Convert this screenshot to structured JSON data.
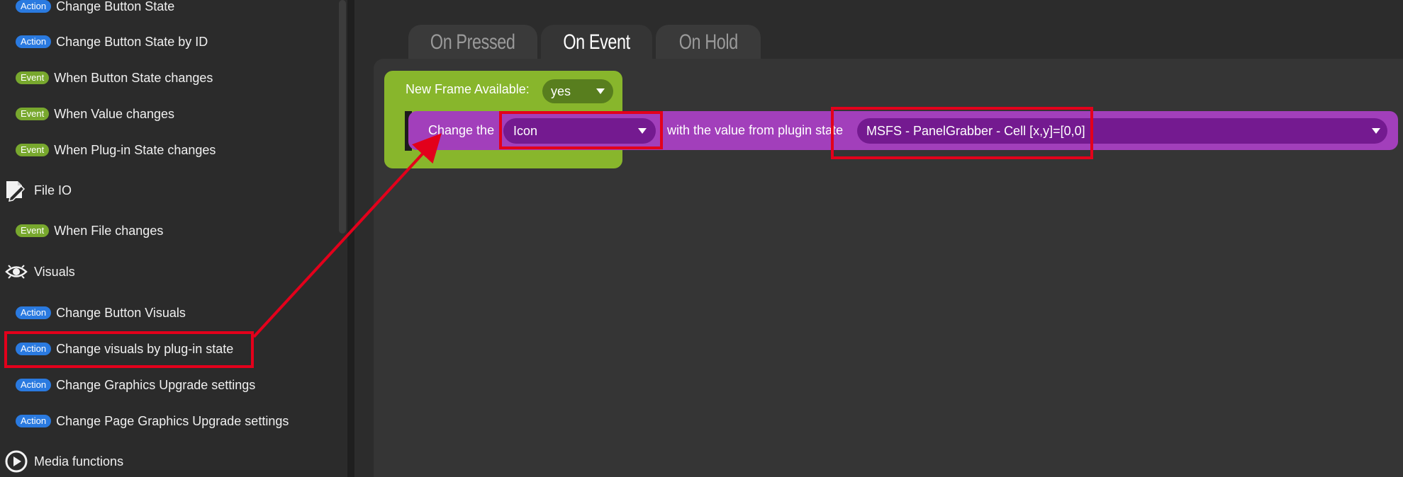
{
  "sidebar": {
    "items": [
      {
        "badge": "Action",
        "label": "Change Button State"
      },
      {
        "badge": "Action",
        "label": "Change Button State by ID"
      },
      {
        "badge": "Event",
        "label": "When Button State changes"
      },
      {
        "badge": "Event",
        "label": "When Value changes"
      },
      {
        "badge": "Event",
        "label": "When Plug-in State changes"
      },
      {
        "badge": "Event",
        "label": "When File changes"
      },
      {
        "badge": "Action",
        "label": "Change Button Visuals"
      },
      {
        "badge": "Action",
        "label": "Change visuals by plug-in state"
      },
      {
        "badge": "Action",
        "label": "Change Graphics Upgrade settings"
      },
      {
        "badge": "Action",
        "label": "Change Page Graphics Upgrade settings"
      }
    ],
    "categories": [
      {
        "label": "File IO",
        "icon": "file-edit-icon"
      },
      {
        "label": "Visuals",
        "icon": "eye-icon"
      },
      {
        "label": "Media functions",
        "icon": "play-icon"
      }
    ]
  },
  "tabs": [
    {
      "label": "On Pressed",
      "active": false
    },
    {
      "label": "On Event",
      "active": true
    },
    {
      "label": "On Hold",
      "active": false
    }
  ],
  "event_block": {
    "label": "New Frame Available:",
    "value": "yes"
  },
  "action_block": {
    "prefix": "Change the",
    "property": "Icon",
    "middle": "with the value from plugin state",
    "state": "MSFS - PanelGrabber - Cell [x,y]=[0,0]"
  },
  "colors": {
    "event_block": "#88b62c",
    "action_block": "#a23fbb",
    "dropdown": "#741a90",
    "action_badge": "#2a7ae0",
    "event_badge": "#78a82e",
    "highlight": "#e3001b"
  }
}
